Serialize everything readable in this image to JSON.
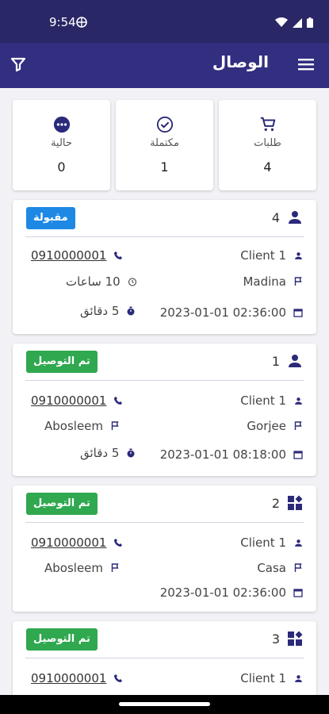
{
  "status": {
    "time": "9:54"
  },
  "appbar": {
    "title": "الوصال"
  },
  "stats": [
    {
      "label": "طلبات",
      "value": "4",
      "icon": "cart-icon"
    },
    {
      "label": "مكتملة",
      "value": "1",
      "icon": "check-circle-icon"
    },
    {
      "label": "حالية",
      "value": "0",
      "icon": "more-circle-icon"
    }
  ],
  "orders": [
    {
      "id": "4",
      "type_icon": "person-icon",
      "badge": "مقبولة",
      "badge_color": "#1e88e5",
      "client": "Client 1",
      "phone": "0910000001",
      "pickup": "Madina",
      "duration": "10 ساعات",
      "datetime": "2023-01-01 02:36:00",
      "eta": "5 دقائق"
    },
    {
      "id": "1",
      "type_icon": "person-icon",
      "badge": "تم التوصيل",
      "badge_color": "#2fa84f",
      "client": "Client 1",
      "phone": "0910000001",
      "pickup": "Gorjee",
      "dropoff": "Abosleem",
      "datetime": "2023-01-01 08:18:00",
      "eta": "5 دقائق"
    },
    {
      "id": "2",
      "type_icon": "widgets-icon",
      "badge": "تم التوصيل",
      "badge_color": "#2fa84f",
      "client": "Client 1",
      "phone": "0910000001",
      "pickup": "Casa",
      "dropoff": "Abosleem",
      "datetime": "2023-01-01 02:36:00"
    },
    {
      "id": "3",
      "type_icon": "widgets-icon",
      "badge": "تم التوصيل",
      "badge_color": "#2fa84f",
      "client": "Client 1",
      "phone": "0910000001"
    }
  ],
  "colors": {
    "primary": "#322e80",
    "statusbar": "#2a2766",
    "icon": "#2b2a7a"
  }
}
